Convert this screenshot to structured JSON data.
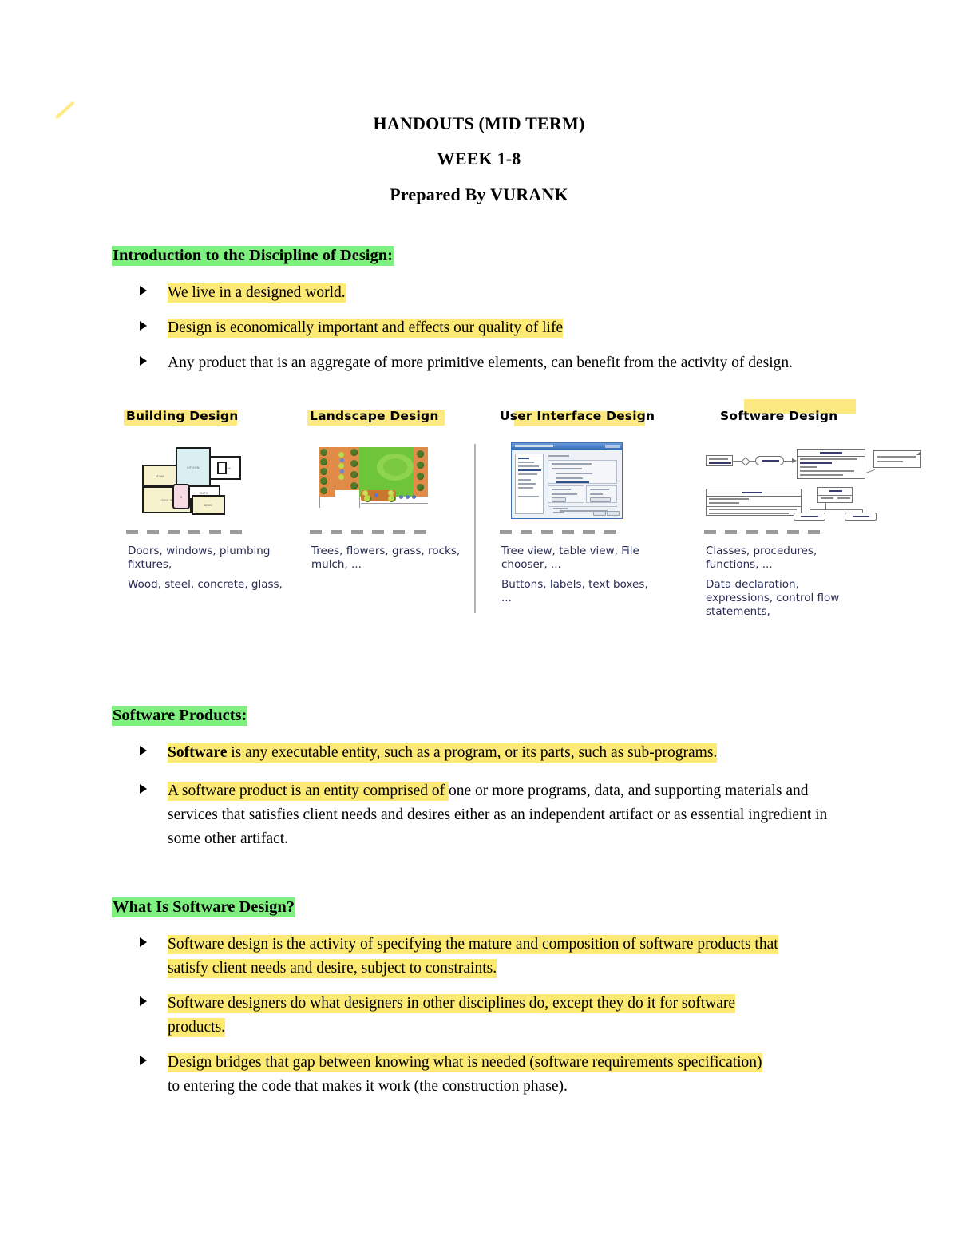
{
  "document": {
    "title_lines": [
      "HANDOUTS (MID TERM)",
      "WEEK 1-8",
      "Prepared By VURANK"
    ]
  },
  "colors": {
    "highlight_yellow": "#fdea74",
    "highlight_green": "#7ff07f",
    "caption_text": "#262b52",
    "divider_gray": "#b4b4b4",
    "dash_gray": "#9a9a9a"
  },
  "sections": [
    {
      "heading": "Introduction to the Discipline of Design:",
      "heading_highlight": "green",
      "bullets": [
        {
          "parts": [
            {
              "text": "We live in a designed world.",
              "highlight": true
            }
          ]
        },
        {
          "parts": [
            {
              "text": "Design is economically important and effects our quality of life",
              "highlight": true
            }
          ]
        },
        {
          "parts": [
            {
              "text": "Any product that is an aggregate of more primitive elements, can benefit from the activity of design.",
              "highlight": false
            }
          ]
        }
      ]
    },
    {
      "heading": "Software Products:",
      "heading_highlight": "green",
      "bullets": [
        {
          "parts": [
            {
              "text": "Software",
              "highlight": true,
              "bold": true
            },
            {
              "text": " is any executable entity, such as a program, or its parts, such as sub-programs.",
              "highlight": true
            }
          ]
        },
        {
          "parts": [
            {
              "text": "A software product is an entity comprised of ",
              "highlight": true
            },
            {
              "text": "one or more programs, data, and supporting materials and services that satisfies client needs and desires either as an independent artifact or as essential ingredient in some other artifact.",
              "highlight": false
            }
          ]
        }
      ]
    },
    {
      "heading": "What Is Software Design?",
      "heading_highlight": "green",
      "bullets": [
        {
          "parts": [
            {
              "text": "Software design is the activity of specifying the mature and composition of software products that satisfy client needs and desire, subject to constraints.",
              "highlight": true
            }
          ]
        },
        {
          "parts": [
            {
              "text": "Software designers do what designers in other disciplines do, except they do it for software products.",
              "highlight": true
            }
          ]
        },
        {
          "parts": [
            {
              "text": "Design bridges that gap between knowing what is needed (software requirements specification)",
              "highlight": true
            },
            {
              "text": " to entering the code that makes it work (the construction phase).",
              "highlight": false
            }
          ]
        }
      ]
    }
  ],
  "design_figure": {
    "columns": [
      {
        "header": "Building Design",
        "header_highlight": "full",
        "image": "floor-plan-thumbnail",
        "captions": [
          "Doors, windows, plumbing fixtures,",
          "Wood, steel, concrete, glass,"
        ]
      },
      {
        "header": "Landscape Design",
        "header_highlight": "full",
        "image": "landscape-plan-thumbnail",
        "captions": [
          "Trees, flowers, grass, rocks, mulch, ..."
        ]
      },
      {
        "header": "User Interface Design",
        "header_highlight": "partial",
        "image": "ui-dialog-screenshot-thumbnail",
        "captions": [
          "Tree view, table view, File chooser, ...",
          "Buttons, labels, text boxes, ..."
        ]
      },
      {
        "header": "Software Design",
        "header_highlight": "offset-stroke",
        "image": "uml-class-diagram-thumbnail",
        "captions": [
          "Classes, procedures, functions, ...",
          "Data declaration, expressions, control flow statements,"
        ]
      }
    ],
    "dash_count_per_column": 6,
    "has_vertical_divider": true
  }
}
